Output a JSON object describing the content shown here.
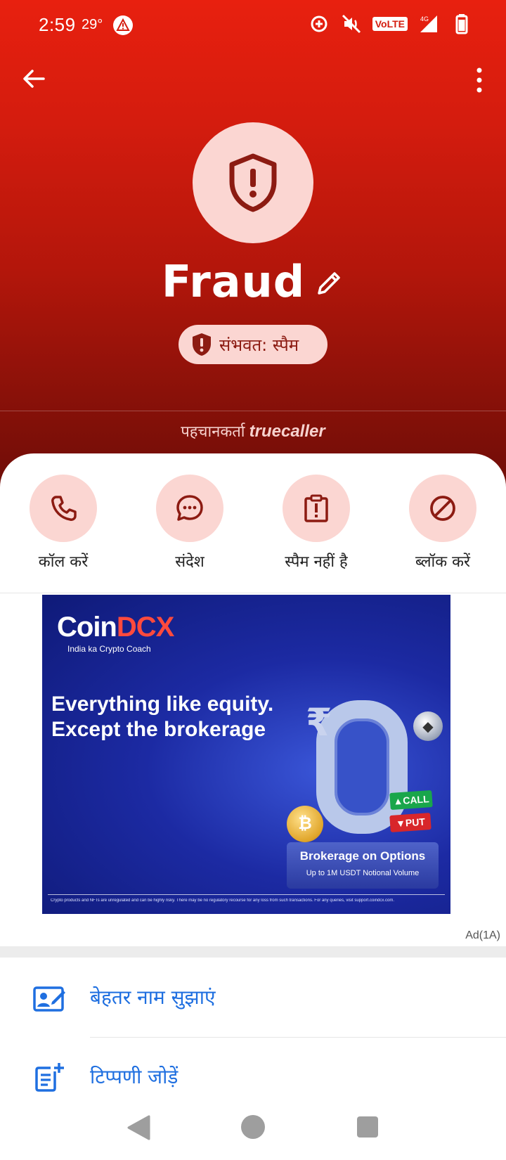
{
  "status_bar": {
    "time": "2:59",
    "temperature": "29°",
    "network": "VoLTE",
    "signal": "4G"
  },
  "profile": {
    "name": "Fraud",
    "spam_badge": "संभवत: स्पैम",
    "identified_prefix": "पहचानकर्ता",
    "brand": "truecaller"
  },
  "actions": [
    {
      "label": "कॉल करें",
      "icon": "phone-icon"
    },
    {
      "label": "संदेश",
      "icon": "message-icon"
    },
    {
      "label": "स्पैम नहीं है",
      "icon": "not-spam-icon"
    },
    {
      "label": "ब्लॉक करें",
      "icon": "block-icon"
    }
  ],
  "ad": {
    "logo_main": "Coin",
    "logo_accent": "DCX",
    "tagline": "India ka Crypto Coach",
    "headline_line1": "Everything like equity.",
    "headline_line2": "Except the brokerage",
    "rupee": "₹",
    "call": "▲CALL",
    "put": "▼PUT",
    "box_title": "Brokerage on Options",
    "box_subtitle": "Up to 1M USDT Notional Volume",
    "disclaimer": "Crypto products and NFTs are unregulated and can be highly risky. There may be no regulatory recourse for any loss from such transactions. For any queries, visit support.coindcx.com.",
    "label": "Ad(1A)"
  },
  "menu": [
    {
      "label": "बेहतर नाम सुझाएं",
      "icon": "suggest-name-icon"
    },
    {
      "label": "टिप्पणी जोड़ें",
      "icon": "add-comment-icon"
    }
  ],
  "colors": {
    "brand_red": "#e8200f",
    "pink_circle": "#fbd6d2",
    "icon_dark_red": "#8c1b12",
    "link_blue": "#1f6fe0"
  }
}
